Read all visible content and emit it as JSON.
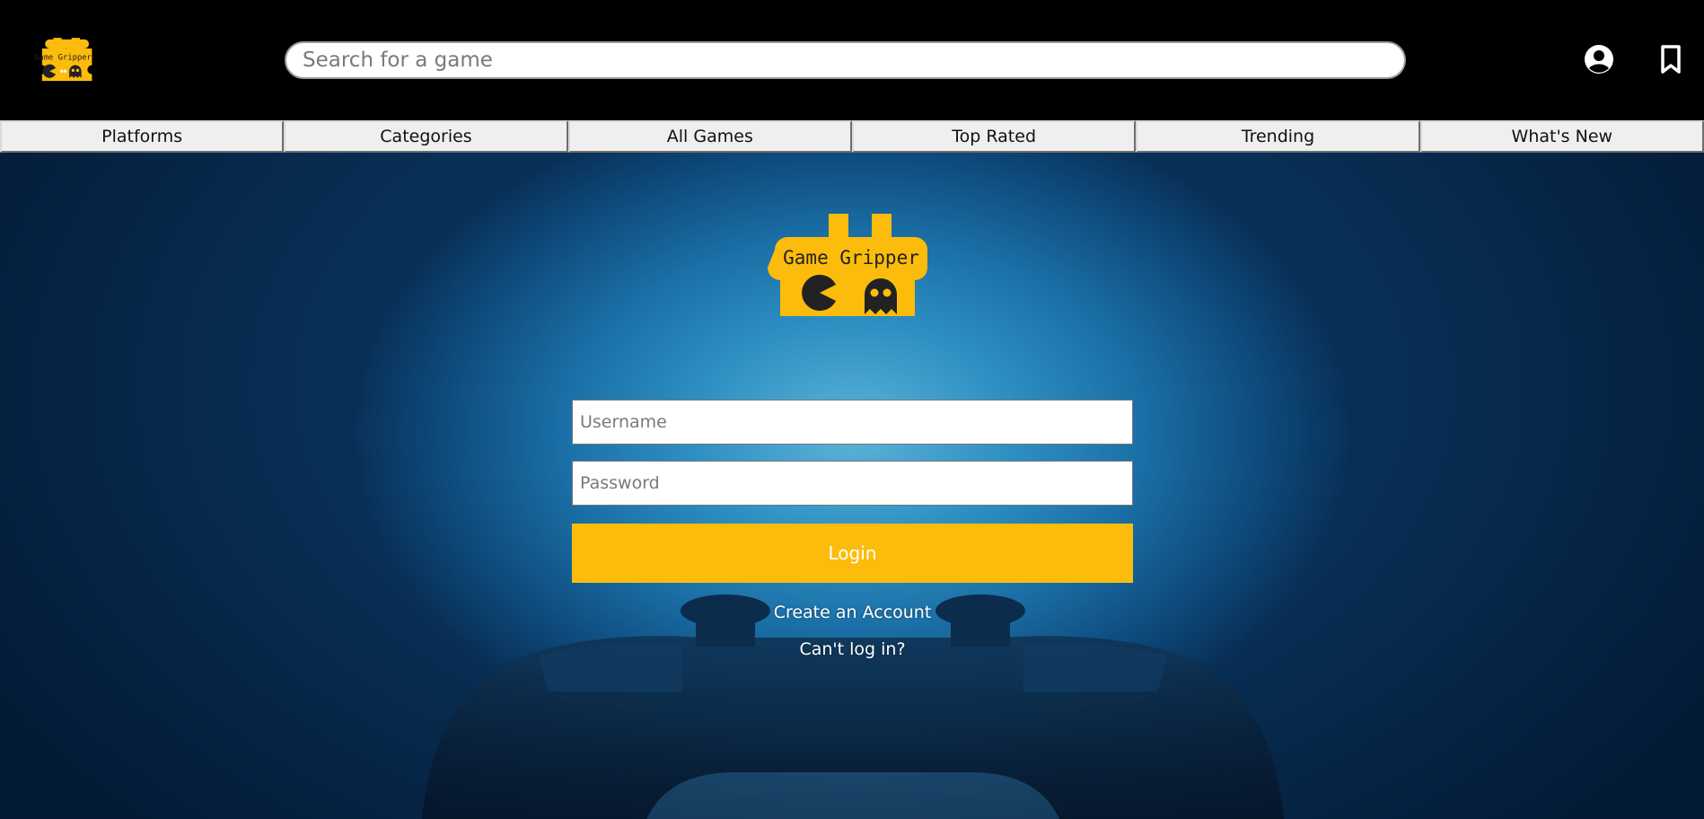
{
  "brand": {
    "logo_text": "Game Gripper",
    "accent_color": "#fcbc0c"
  },
  "header": {
    "search": {
      "placeholder": "Search for a game",
      "value": ""
    },
    "icons": [
      "account-circle-icon",
      "bookmark-icon"
    ]
  },
  "nav": {
    "items": [
      {
        "label": "Platforms"
      },
      {
        "label": "Categories"
      },
      {
        "label": "All Games"
      },
      {
        "label": "Top Rated"
      },
      {
        "label": "Trending"
      },
      {
        "label": "What's New"
      }
    ]
  },
  "login": {
    "username_placeholder": "Username",
    "password_placeholder": "Password",
    "login_label": "Login",
    "create_account_label": "Create an Account",
    "cant_login_label": "Can't log in?"
  }
}
